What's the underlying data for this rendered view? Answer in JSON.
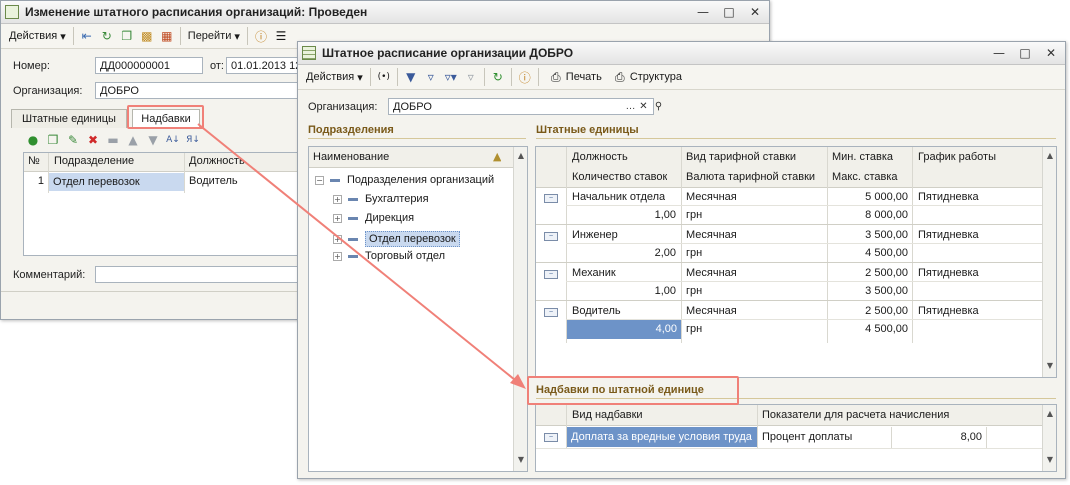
{
  "back_window": {
    "title": "Изменение штатного расписания организаций: Проведен",
    "toolbar": {
      "actions": "Действия",
      "goto": "Перейти"
    },
    "number_label": "Номер:",
    "number_value": "ДД000000001",
    "date_label": "от:",
    "date_value": "01.01.2013 12",
    "org_label": "Организация:",
    "org_value": "ДОБРО",
    "tabs": [
      "Штатные единицы",
      "Надбавки"
    ],
    "grid_headers": [
      "№",
      "Подразделение",
      "Должность"
    ],
    "grid_row": {
      "n": "1",
      "division": "Отдел перевозок",
      "position": "Водитель"
    },
    "comment_label": "Комментарий:"
  },
  "front_window": {
    "title": "Штатное расписание организации ДОБРО",
    "toolbar": {
      "actions": "Действия",
      "print": "Печать",
      "structure": "Структура"
    },
    "org_label": "Организация:",
    "org_value": "ДОБРО",
    "divisions_title": "Подразделения",
    "divisions_header": "Наименование",
    "tree": {
      "root": "Подразделения организаций",
      "children": [
        "Бухгалтерия",
        "Дирекция",
        "Отдел перевозок",
        "Торговый отдел"
      ]
    },
    "units_title": "Штатные единицы",
    "units_headers": {
      "position": "Должность",
      "count": "Количество ставок",
      "rate_type": "Вид тарифной ставки",
      "currency": "Валюта тарифной ставки",
      "min_rate": "Мин. ставка",
      "max_rate": "Макс. ставка",
      "schedule": "График работы"
    },
    "units_rows": [
      {
        "position": "Начальник отдела",
        "count": "1,00",
        "rate_type": "Месячная",
        "currency": "грн",
        "min": "5 000,00",
        "max": "8 000,00",
        "schedule": "Пятидневка"
      },
      {
        "position": "Инженер",
        "count": "2,00",
        "rate_type": "Месячная",
        "currency": "грн",
        "min": "3 500,00",
        "max": "4 500,00",
        "schedule": "Пятидневка"
      },
      {
        "position": "Механик",
        "count": "1,00",
        "rate_type": "Месячная",
        "currency": "грн",
        "min": "2 500,00",
        "max": "3 500,00",
        "schedule": "Пятидневка"
      },
      {
        "position": "Водитель",
        "count": "4,00",
        "rate_type": "Месячная",
        "currency": "грн",
        "min": "2 500,00",
        "max": "4 500,00",
        "schedule": "Пятидневка"
      }
    ],
    "allowances_title": "Надбавки по штатной единице",
    "allowances_headers": {
      "type": "Вид надбавки",
      "indicators": "Показатели для расчета начисления"
    },
    "allowances_row": {
      "type": "Доплата за вредные условия труда",
      "indicator": "Процент доплаты",
      "value": "8,00"
    }
  },
  "colors": {
    "selection": "#6d93c8",
    "section_title": "#7a5a1a",
    "highlight": "#f08078"
  }
}
